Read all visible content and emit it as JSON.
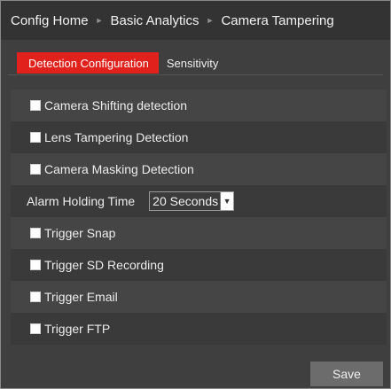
{
  "breadcrumb": {
    "items": [
      "Config Home",
      "Basic Analytics",
      "Camera Tampering"
    ],
    "separator": "►"
  },
  "tabs": [
    {
      "label": "Detection Configuration",
      "active": true
    },
    {
      "label": "Sensitivity",
      "active": false
    }
  ],
  "options": {
    "camera_shifting": {
      "label": "Camera Shifting detection",
      "checked": false
    },
    "lens_tampering": {
      "label": "Lens Tampering Detection",
      "checked": false
    },
    "camera_masking": {
      "label": "Camera Masking Detection",
      "checked": false
    }
  },
  "alarm_holding": {
    "label": "Alarm Holding Time",
    "value": "20 Seconds",
    "arrow_icon": "chevron-down-icon"
  },
  "triggers": {
    "snap": {
      "label": "Trigger Snap",
      "checked": false
    },
    "sd_recording": {
      "label": "Trigger SD Recording",
      "checked": false
    },
    "email": {
      "label": "Trigger Email",
      "checked": false
    },
    "ftp": {
      "label": "Trigger FTP",
      "checked": false
    }
  },
  "save_label": "Save",
  "colors": {
    "accent": "#e0211c",
    "background": "#3f3f3f",
    "header": "#333333",
    "button": "#6c6c6c"
  }
}
